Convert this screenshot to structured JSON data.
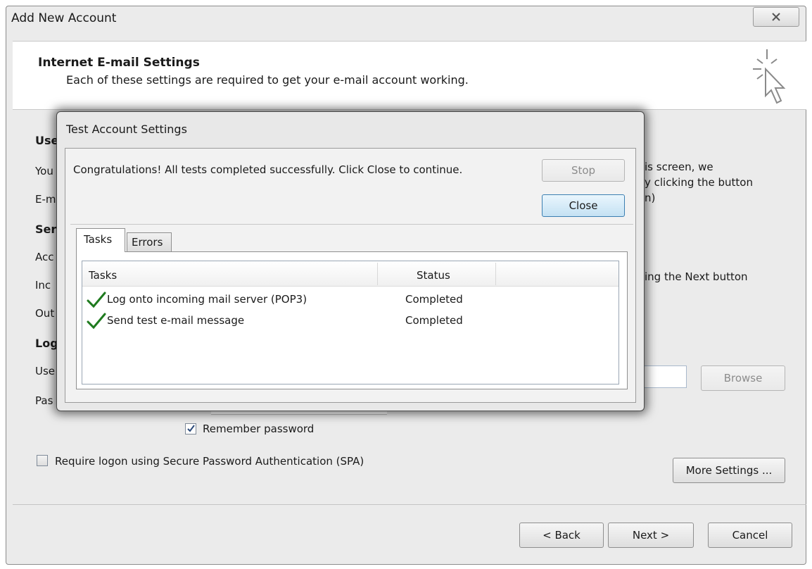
{
  "window": {
    "title": "Add New Account",
    "close_glyph": "⌧"
  },
  "header": {
    "title": "Internet E-mail Settings",
    "subtitle": "Each of these settings are required to get your e-mail account working.",
    "icon": "cursor-sparkle-icon"
  },
  "background_form": {
    "partial_labels": [
      "Use",
      "You",
      "E-m",
      "Ser",
      "Acc",
      "Inc",
      "Out",
      "Log",
      "Use",
      "Pas"
    ],
    "right_text": {
      "line1": "is screen, we",
      "line2": "y clicking the button",
      "line3": "n)",
      "line4": "ing the Next button"
    },
    "browse_label": "Browse",
    "remember_label": "Remember password",
    "remember_checked": true,
    "spa_label": "Require logon using Secure Password Authentication (SPA)",
    "spa_checked": false,
    "more_settings_label": "More Settings ..."
  },
  "footer": {
    "back_label": "< Back",
    "next_label": "Next >",
    "cancel_label": "Cancel"
  },
  "dialog": {
    "title": "Test Account Settings",
    "message": "Congratulations! All tests completed successfully. Click Close to continue.",
    "stop_label": "Stop",
    "close_label": "Close",
    "tabs": [
      {
        "label": "Tasks",
        "active": true
      },
      {
        "label": "Errors",
        "active": false
      }
    ],
    "columns": [
      "Tasks",
      "Status"
    ],
    "rows": [
      {
        "task": "Log onto incoming mail server (POP3)",
        "status": "Completed",
        "icon": "green-check-icon"
      },
      {
        "task": "Send test e-mail message",
        "status": "Completed",
        "icon": "green-check-icon"
      }
    ]
  },
  "colors": {
    "window_bg": "#ebebeb",
    "check_green": "#1e7a1e",
    "default_button_border": "#3c7fb1"
  }
}
